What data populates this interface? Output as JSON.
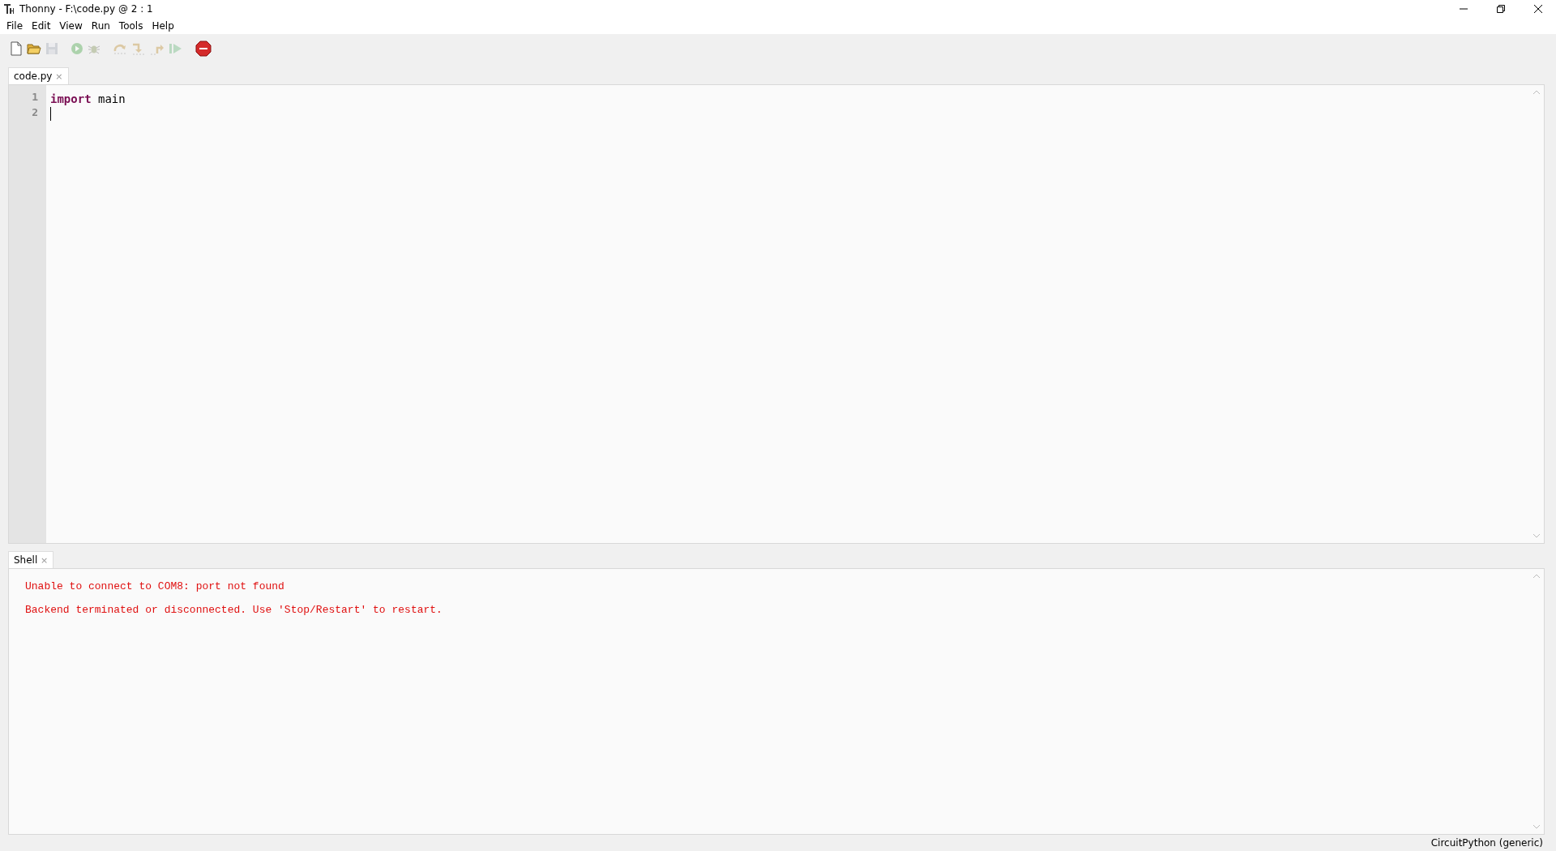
{
  "window": {
    "title": "Thonny  -  F:\\code.py  @  2 : 1"
  },
  "menu": [
    "File",
    "Edit",
    "View",
    "Run",
    "Tools",
    "Help"
  ],
  "toolbar": [
    {
      "kind": "new",
      "disabled": false
    },
    {
      "kind": "open",
      "disabled": false
    },
    {
      "kind": "save",
      "disabled": true
    },
    {
      "kind": "run",
      "disabled": true
    },
    {
      "kind": "debug",
      "disabled": true
    },
    {
      "kind": "step-over",
      "disabled": true
    },
    {
      "kind": "step-into",
      "disabled": true
    },
    {
      "kind": "step-out",
      "disabled": true
    },
    {
      "kind": "resume",
      "disabled": true
    },
    {
      "kind": "stop",
      "disabled": false
    }
  ],
  "editor": {
    "tab": {
      "label": "code.py",
      "close": "×"
    },
    "lines": [
      {
        "number": "1",
        "cursor": false,
        "tokens": [
          {
            "kind": "keyword",
            "text": "import"
          },
          {
            "kind": "plain",
            "text": " main"
          }
        ]
      },
      {
        "number": "2",
        "cursor": true
      }
    ]
  },
  "shell": {
    "tab": {
      "label": "Shell",
      "close": "×"
    },
    "lines": [
      "Unable to connect to COM8: port not found",
      "Backend terminated or disconnected. Use 'Stop/Restart' to restart."
    ]
  },
  "status_bar": {
    "interpreter": "CircuitPython (generic)"
  }
}
